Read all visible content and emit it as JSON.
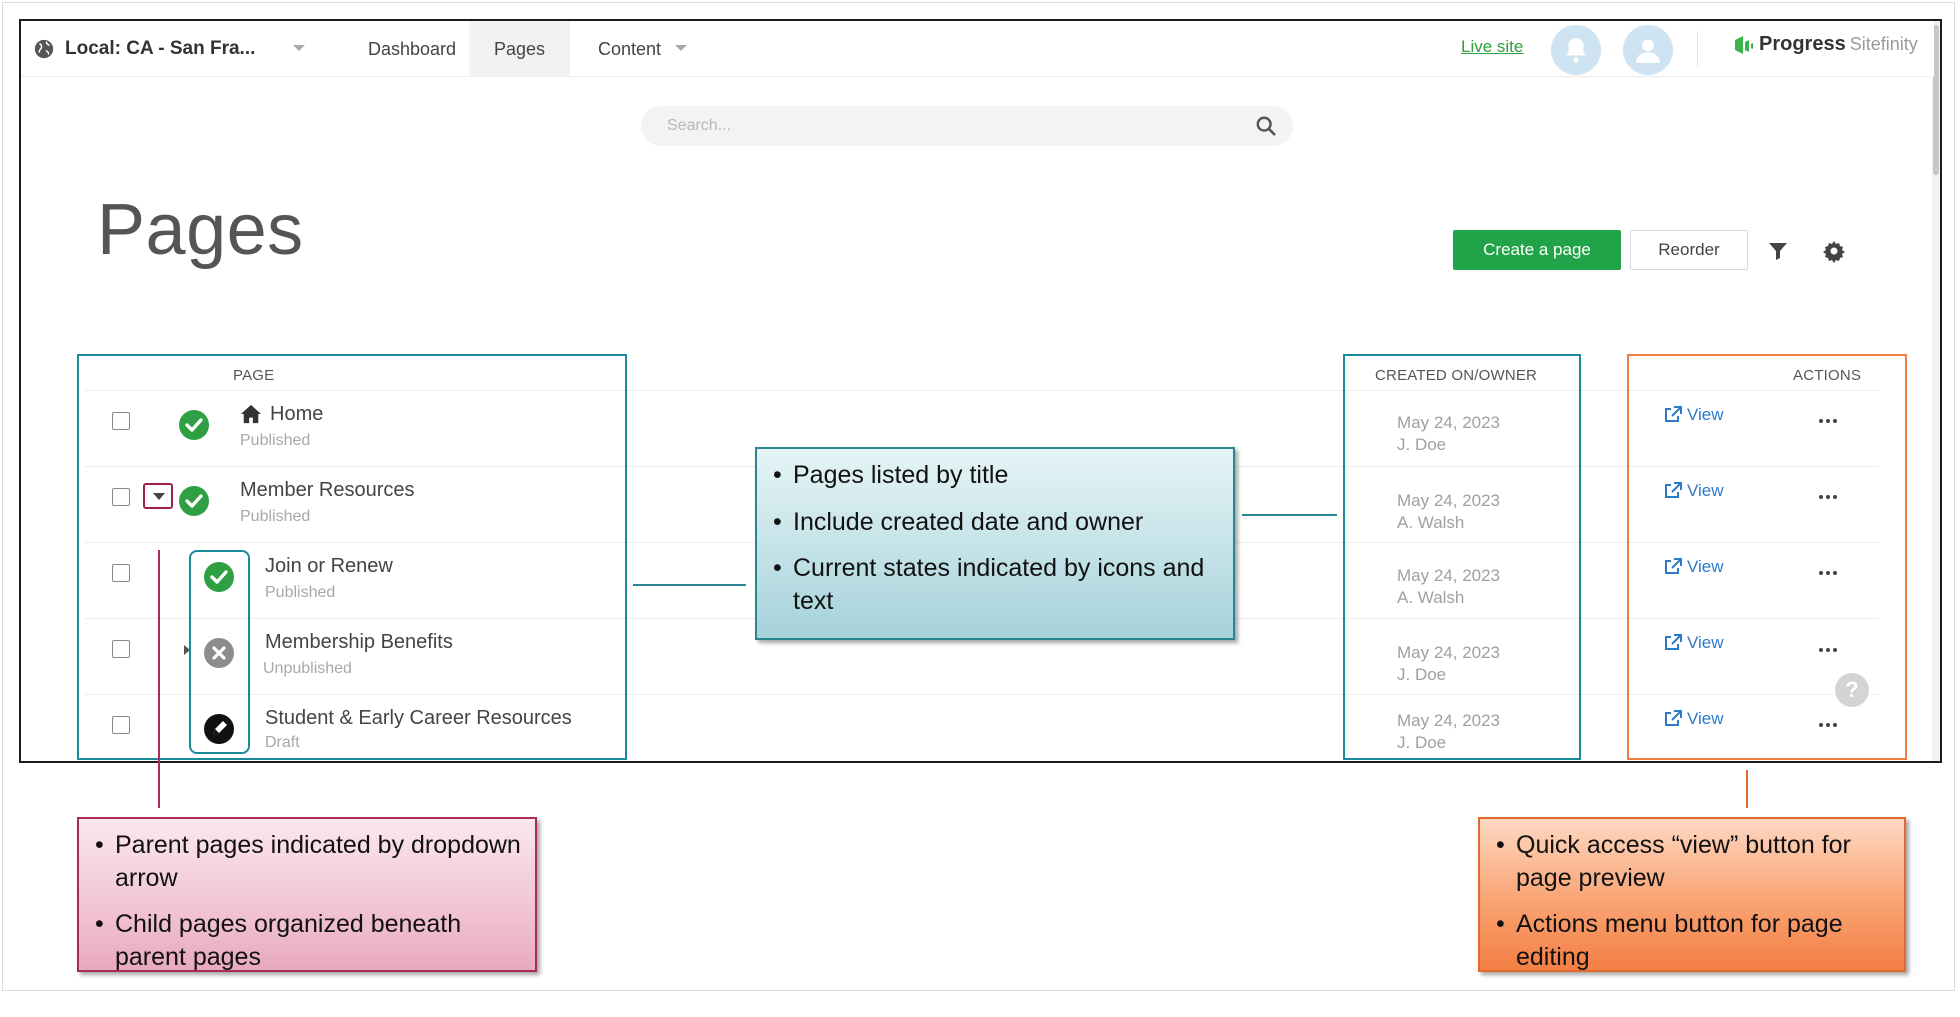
{
  "topbar": {
    "site_label": "Local: CA - San Fra...",
    "nav": [
      "Dashboard",
      "Pages",
      "Content"
    ],
    "active_nav": "Pages",
    "live_site": "Live site",
    "brand_name": "Progress",
    "brand_product": "Sitefinity"
  },
  "search": {
    "placeholder": "Search..."
  },
  "page_title": "Pages",
  "toolbar": {
    "create_label": "Create a page",
    "reorder_label": "Reorder"
  },
  "table": {
    "headers": {
      "page": "PAGE",
      "created": "CREATED ON/OWNER",
      "actions": "ACTIONS"
    },
    "rows": [
      {
        "title": "Home",
        "state": "Published",
        "status": "published",
        "date": "May 24, 2023",
        "owner": "J. Doe",
        "view": "View"
      },
      {
        "title": "Member Resources",
        "state": "Published",
        "status": "published",
        "date": "May 24, 2023",
        "owner": "A. Walsh",
        "view": "View"
      },
      {
        "title": "Join or Renew",
        "state": "Published",
        "status": "published",
        "date": "May 24, 2023",
        "owner": "A. Walsh",
        "view": "View"
      },
      {
        "title": "Membership Benefits",
        "state": "Unpublished",
        "status": "unpublished",
        "date": "May 24, 2023",
        "owner": "J. Doe",
        "view": "View"
      },
      {
        "title": "Student & Early Career Resources",
        "state": "Draft",
        "status": "draft",
        "date": "May 24, 2023",
        "owner": "J. Doe",
        "view": "View"
      }
    ]
  },
  "colors": {
    "accent_green": "#21a34a",
    "status_published": "#2ea043",
    "status_unpublished": "#8c8c8c",
    "status_draft": "#111111",
    "callout_teal": "#2a8593",
    "callout_pink": "#a82b5c",
    "callout_orange": "#f47f44"
  },
  "callouts": {
    "teal": [
      "Pages listed by title",
      "Include created date and owner",
      "Current states indicated by icons and text"
    ],
    "pink": [
      "Parent pages indicated by dropdown arrow",
      "Child pages organized beneath parent pages"
    ],
    "orange": [
      "Quick access “view” button for page preview",
      "Actions menu button for page editing"
    ]
  }
}
